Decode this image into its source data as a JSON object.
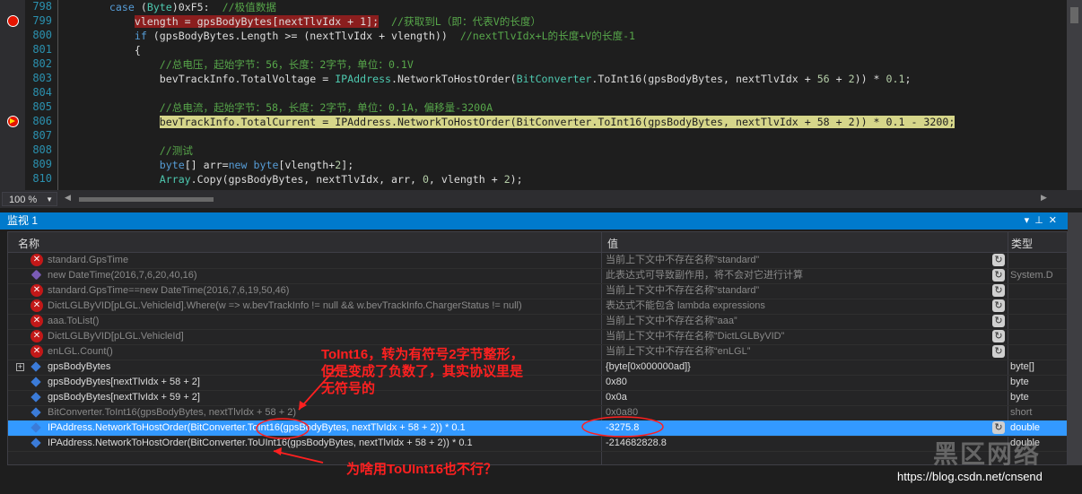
{
  "editor": {
    "zoom": "100 %",
    "lines": [
      {
        "n": "798",
        "html": "<span class=\"kw\">case</span> (<span class=\"tp\">Byte</span>)0xF5:  <span class=\"cm\">//极值数据</span>",
        "indent": "    "
      },
      {
        "n": "799",
        "html": "<span class=\"bp-hl\">vlength = gpsBodyBytes[nextTlvIdx + 1];</span>  <span class=\"cm\">//获取到L（即：代表V的长度）</span>",
        "indent": "        "
      },
      {
        "n": "800",
        "html": "<span class=\"kw\">if</span> (gpsBodyBytes.Length >= (nextTlvIdx + vlength))  <span class=\"cm\">//nextTlvIdx+L的长度+V的长度-1</span>",
        "indent": "        "
      },
      {
        "n": "801",
        "html": "{",
        "indent": "        "
      },
      {
        "n": "802",
        "html": "<span class=\"cm\">//总电压，起始字节：56，长度：2字节，单位：0.1V</span>",
        "indent": "            "
      },
      {
        "n": "803",
        "html": "bevTrackInfo.TotalVoltage = <span class=\"tp\">IPAddress</span>.NetworkToHostOrder(<span class=\"tp\">BitConverter</span>.ToInt16(gpsBodyBytes, nextTlvIdx + <span class=\"nm\">56</span> + <span class=\"nm\">2</span>)) * <span class=\"nm\">0.1</span>;",
        "indent": "            "
      },
      {
        "n": "804",
        "html": "",
        "indent": ""
      },
      {
        "n": "805",
        "html": "<span class=\"cm\">//总电流，起始字节：58，长度：2字节，单位：0.1A，偏移量-3200A</span>",
        "indent": "            "
      },
      {
        "n": "806",
        "html": "<span class=\"cur-hl\">bevTrackInfo.TotalCurrent = <span class=\"tp\">IPAddress</span>.NetworkToHostOrder(<span class=\"tp\">BitConverter</span>.ToInt16(gpsBodyBytes, nextTlvIdx + <span class=\"nm\">58</span> + <span class=\"nm\">2</span>)) * <span class=\"nm\">0.1</span> - <span class=\"nm\">3200</span>;</span>",
        "indent": "            "
      },
      {
        "n": "807",
        "html": "",
        "indent": ""
      },
      {
        "n": "808",
        "html": "<span class=\"cm\">//测试</span>",
        "indent": "            "
      },
      {
        "n": "809",
        "html": "<span class=\"kw\">byte</span>[] arr=<span class=\"kw\">new</span> <span class=\"kw\">byte</span>[vlength+<span class=\"nm\">2</span>];",
        "indent": "            "
      },
      {
        "n": "810",
        "html": "<span class=\"tp\">Array</span>.Copy(gpsBodyBytes, nextTlvIdx, arr, <span class=\"nm\">0</span>, vlength + <span class=\"nm\">2</span>);",
        "indent": "            "
      }
    ]
  },
  "watch": {
    "title": "监视 1",
    "col_name": "名称",
    "col_value": "值",
    "col_type": "类型",
    "rows": [
      {
        "icon": "error",
        "name": "standard.GpsTime",
        "value": "当前上下文中不存在名称“standard”",
        "type": "",
        "gray": true,
        "refresh": true
      },
      {
        "icon": "warn",
        "name": "new DateTime(2016,7,6,20,40,16)",
        "value": "此表达式可导致副作用，将不会对它进行计算",
        "type": "System.D",
        "gray": true,
        "refresh": true
      },
      {
        "icon": "error",
        "name": "standard.GpsTime==new DateTime(2016,7,6,19,50,46)",
        "value": "当前上下文中不存在名称“standard”",
        "type": "",
        "gray": true,
        "refresh": true
      },
      {
        "icon": "error",
        "name": "DictLGLByVID[pLGL.VehicleId].Where(w => w.bevTrackInfo != null && w.bevTrackInfo.ChargerStatus != null)",
        "value": "表达式不能包含 lambda expressions",
        "type": "",
        "gray": true,
        "refresh": true
      },
      {
        "icon": "error",
        "name": "aaa.ToList()",
        "value": "当前上下文中不存在名称“aaa”",
        "type": "",
        "gray": true,
        "refresh": true
      },
      {
        "icon": "error",
        "name": "DictLGLByVID[pLGL.VehicleId]",
        "value": "当前上下文中不存在名称“DictLGLByVID”",
        "type": "",
        "gray": true,
        "refresh": true
      },
      {
        "icon": "error",
        "name": "enLGL.Count()",
        "value": "当前上下文中不存在名称“enLGL”",
        "type": "",
        "gray": true,
        "refresh": true
      },
      {
        "icon": "box",
        "expand": true,
        "name": "gpsBodyBytes",
        "value": "{byte[0x000000ad]}",
        "type": "byte[]",
        "gray": false,
        "refresh": false
      },
      {
        "icon": "box",
        "name": "gpsBodyBytes[nextTlvIdx + 58 + 2]",
        "value": "0x80",
        "type": "byte",
        "gray": false,
        "refresh": false
      },
      {
        "icon": "box",
        "name": "gpsBodyBytes[nextTlvIdx + 59 + 2]",
        "value": "0x0a",
        "type": "byte",
        "gray": false,
        "refresh": false
      },
      {
        "icon": "box",
        "name": "BitConverter.ToInt16(gpsBodyBytes, nextTlvIdx + 58 + 2)",
        "value": "0x0a80",
        "type": "short",
        "gray": true,
        "refresh": false
      },
      {
        "icon": "box",
        "name": "IPAddress.NetworkToHostOrder(BitConverter.ToInt16(gpsBodyBytes, nextTlvIdx + 58 + 2)) * 0.1",
        "value": "-3275.8",
        "type": "double",
        "gray": false,
        "refresh": true,
        "selected": true
      },
      {
        "icon": "box",
        "name": "IPAddress.NetworkToHostOrder(BitConverter.ToUInt16(gpsBodyBytes, nextTlvIdx + 58 + 2)) * 0.1",
        "value": "-214682828.8",
        "type": "double",
        "gray": false,
        "refresh": false
      }
    ]
  },
  "annotations": {
    "note1_line1": "ToInt16，转为有符号2字节整形，",
    "note1_line2": "但是变成了负数了，其实协议里是",
    "note1_line3": "无符号的",
    "note2": "为啥用ToUInt16也不行？"
  },
  "watermark": {
    "url": "https://blog.csdn.net/cnsend",
    "brand": "黑区网络"
  },
  "colors": {
    "annotation": "#ff2020",
    "selection": "#3399ff",
    "titlebar": "#007acc"
  }
}
